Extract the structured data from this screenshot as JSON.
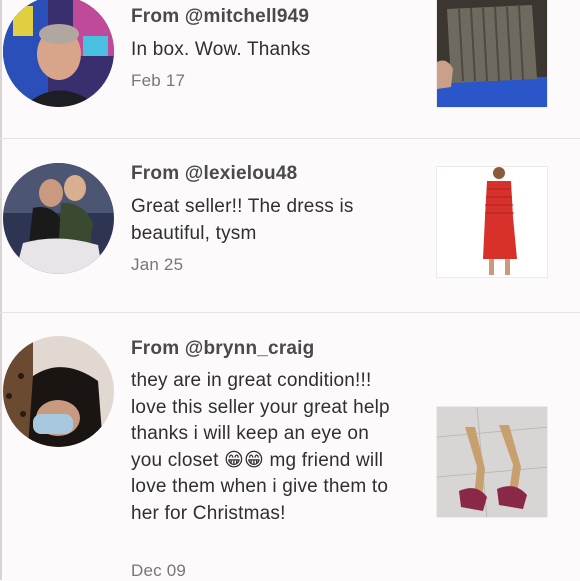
{
  "reviews": [
    {
      "from": "From @mitchell949",
      "text": "In box. Wow. Thanks",
      "date": "Feb 17",
      "avatar_icon": "man-avatar-photo",
      "product_icon": "grey-fabric-product-photo"
    },
    {
      "from": "From @lexielou48",
      "text": "Great seller!! The dress is beautiful, tysm",
      "date": "Jan 25",
      "avatar_icon": "group-photo-avatar",
      "product_icon": "red-dress-product-photo"
    },
    {
      "from": "From @brynn_craig",
      "text_before_emoji": "they are in great condition!!! love this seller your great help thanks i will keep an eye on you closet ",
      "emoji": "😁😁",
      "text_after_emoji": " mg friend will love them when i give them to her for Christmas!",
      "date": "Dec 09",
      "avatar_icon": "masked-woman-avatar-photo",
      "product_icon": "heels-product-photo"
    }
  ],
  "colors": {
    "background": "#fcfafa",
    "heading_text": "#4a4a4a",
    "body_text": "#2f2f2f",
    "date_text": "#777777",
    "divider": "#e6e2e2"
  }
}
